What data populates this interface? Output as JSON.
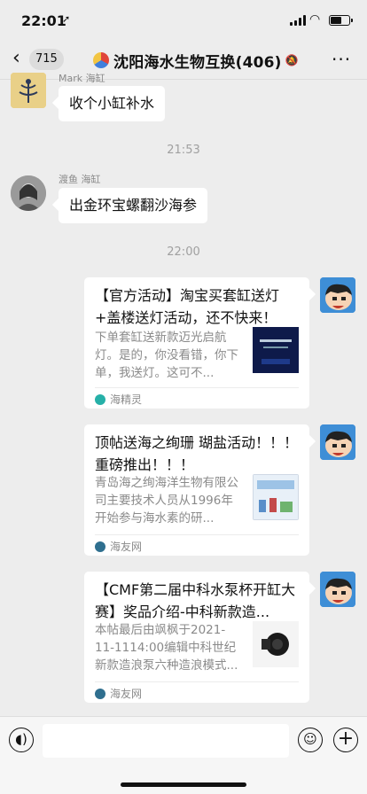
{
  "status": {
    "time": "22:01",
    "location_icon": "location-arrow-icon",
    "battery_level_pct": 60
  },
  "nav": {
    "back_icon": "chevron-left-icon",
    "unread_count": "715",
    "title": "沈阳海水生物互换(406)",
    "mute_icon": "muted-bell-icon",
    "more_label": "···"
  },
  "messages": [
    {
      "sender": "Mark 海缸",
      "text": "收个小缸补水"
    },
    {
      "timestamp": "21:53"
    },
    {
      "sender": "渡鱼 海缸",
      "text": "出金环宝螺翻沙海参"
    },
    {
      "timestamp": "22:00"
    }
  ],
  "cards": [
    {
      "title": "【官方活动】淘宝买套缸送灯+盖楼送灯活动，还不快来！",
      "desc": "下单套缸送新款迈光启航灯。是的，你没看错，你下单，我送灯。这可不...",
      "source": "海精灵"
    },
    {
      "title": "顶帖送海之绚珊 瑚盐活动！！！重磅推出！！！",
      "desc": "青岛海之绚海洋生物有限公司主要技术人员从1996年开始参与海水素的研...",
      "source": "海友网"
    },
    {
      "title": "【CMF第二届中科水泵杯开缸大赛】奖品介绍-中科新款造...",
      "desc": "本帖最后由飒枫于2021-11-1114:00编辑中科世纪新款造浪泵六种造浪模式...",
      "source": "海友网"
    }
  ],
  "input": {
    "voice_icon": "voice-icon",
    "emoji_icon": "emoji-icon",
    "plus_icon": "plus-icon"
  }
}
